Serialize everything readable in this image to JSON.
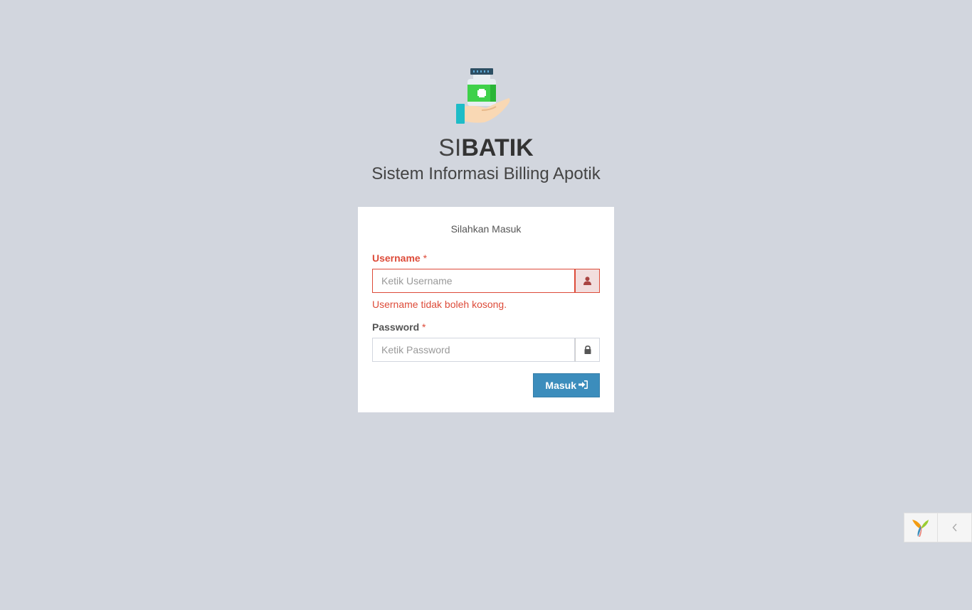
{
  "brand": {
    "prefix": "SI",
    "name": "BATIK",
    "subtitle": "Sistem Informasi Billing Apotik",
    "logo_icon": "medicine-bottle-hand-icon"
  },
  "login": {
    "message": "Silahkan Masuk",
    "username": {
      "label": "Username",
      "required_mark": "*",
      "placeholder": "Ketik Username",
      "value": "",
      "error": "Username tidak boleh kosong.",
      "icon": "user-icon"
    },
    "password": {
      "label": "Password",
      "required_mark": "*",
      "placeholder": "Ketik Password",
      "value": "",
      "icon": "lock-icon"
    },
    "submit_label": "Masuk",
    "submit_icon": "sign-in-icon"
  },
  "debug_toolbar": {
    "logo_icon": "yii-logo-icon",
    "toggle_icon": "chevron-left-icon"
  },
  "colors": {
    "background": "#d2d6de",
    "primary": "#3c8dbc",
    "error": "#dd4b39"
  }
}
